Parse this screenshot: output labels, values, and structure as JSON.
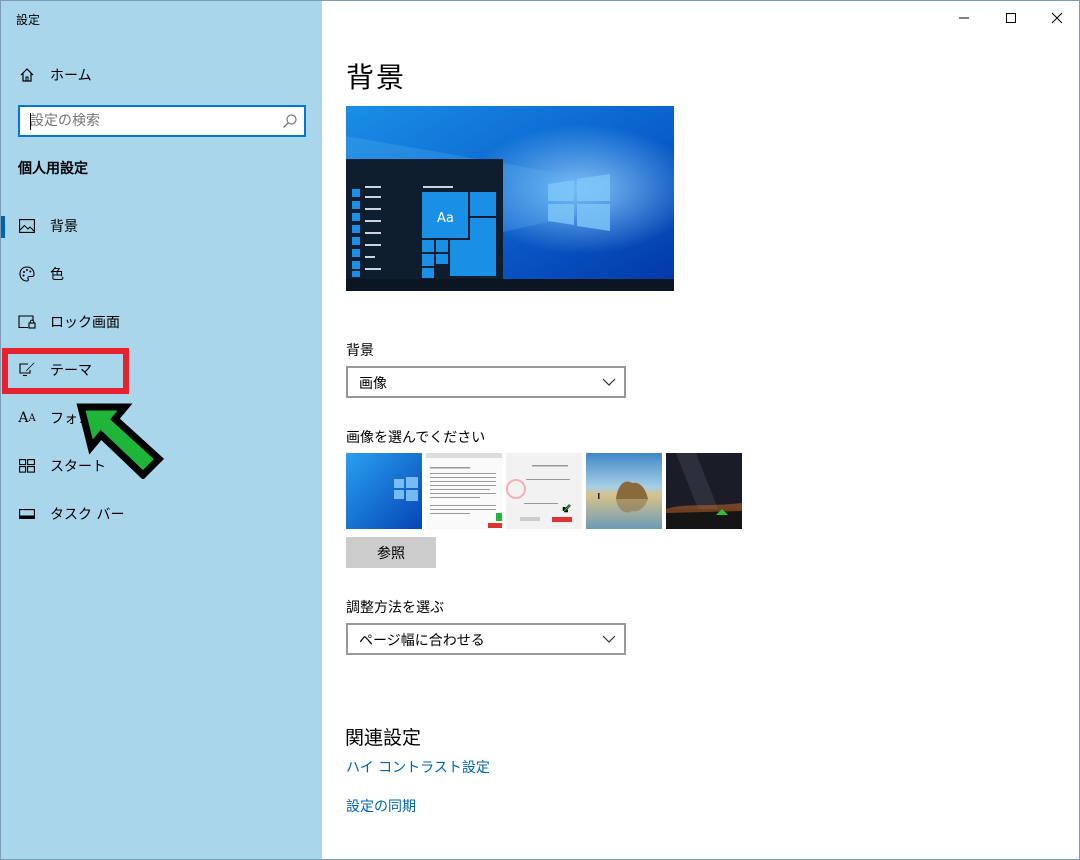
{
  "window": {
    "title": "設定",
    "controls": {
      "minimize": "minimize",
      "maximize": "maximize",
      "close": "close"
    }
  },
  "sidebar": {
    "home_label": "ホーム",
    "search_placeholder": "設定の検索",
    "section_title": "個人用設定",
    "items": [
      {
        "label": "背景",
        "icon": "picture-icon",
        "selected": true
      },
      {
        "label": "色",
        "icon": "palette-icon"
      },
      {
        "label": "ロック画面",
        "icon": "lock-screen-icon"
      },
      {
        "label": "テーマ",
        "icon": "theme-brush-icon"
      },
      {
        "label": "フォント",
        "icon": "font-icon"
      },
      {
        "label": "スタート",
        "icon": "start-tiles-icon"
      },
      {
        "label": "タスク バー",
        "icon": "taskbar-icon"
      }
    ]
  },
  "annotation": {
    "highlight_color": "#e8212e",
    "arrow_color": "#1fb53a"
  },
  "main": {
    "title": "背景",
    "preview": {
      "sample_text": "Aa"
    },
    "background_label": "背景",
    "background_value": "画像",
    "choose_image_label": "画像を選んでください",
    "browse_button": "参照",
    "fit_label": "調整方法を選ぶ",
    "fit_value": "ページ幅に合わせる",
    "related_heading": "関連設定",
    "links": [
      "ハイ コントラスト設定",
      "設定の同期"
    ]
  },
  "colors": {
    "sidebar_bg": "#aad6ec",
    "accent": "#0078d7",
    "link": "#0063b1"
  }
}
